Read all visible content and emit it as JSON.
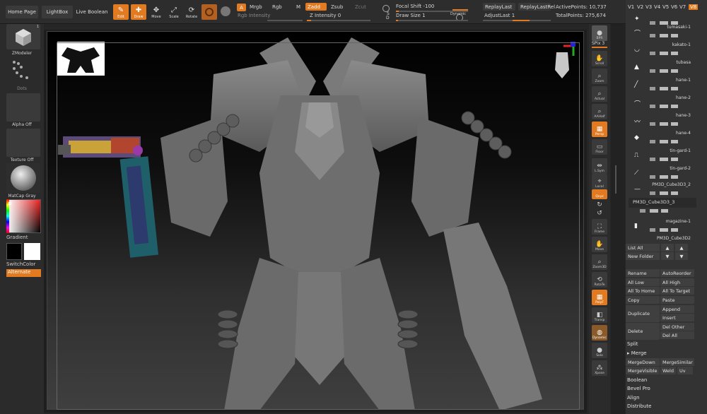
{
  "topbar": {
    "home_page": "Home Page",
    "lightbox": "LightBox",
    "live_boolean": "Live Boolean",
    "tools": [
      {
        "label": "Edit",
        "icon": "edit-icon",
        "active": true
      },
      {
        "label": "Draw",
        "icon": "draw-icon",
        "active": true
      },
      {
        "label": "Move",
        "icon": "move-icon",
        "active": false
      },
      {
        "label": "Scale",
        "icon": "scale-icon",
        "active": false
      },
      {
        "label": "Rotate",
        "icon": "rotate-icon",
        "active": false
      }
    ],
    "a_label": "A",
    "mrgb": "Mrgb",
    "rgb": "Rgb",
    "m": "M",
    "zadd": "Zadd",
    "zsub": "Zsub",
    "zcut": "Zcut",
    "rgb_intensity": "Rgb Intensity",
    "z_intensity": "Z Intensity 0",
    "focal_shift": "Focal Shift -100",
    "draw_size": "Draw Size 1",
    "dynamic": "Dynamic",
    "replay_last": "ReplayLast",
    "replay_last_rel": "ReplayLastRel",
    "adjust_last": "AdjustLast 1",
    "active_points": "ActivePoints: 10,737",
    "total_points": "TotalPoints: 275,674",
    "s_label": "S",
    "d_label": "D"
  },
  "left_shelf": {
    "zmodeler": "ZModeler",
    "dots": "Dots",
    "alpha": "Alpha Off",
    "texture": "Texture Off",
    "matcap": "MatCap Gray",
    "gradient": "Gradient",
    "switch_color": "SwitchColor",
    "alternate": "Alternate",
    "zmodeler_badge": "1"
  },
  "right_shelf": [
    {
      "label": "BPR",
      "icon": "sphere-icon",
      "active": false
    },
    {
      "label": "SPix 3",
      "icon": "",
      "active": false
    },
    {
      "label": "Scroll",
      "icon": "scroll-icon",
      "active": false
    },
    {
      "label": "Zoom",
      "icon": "zoom-icon",
      "active": false
    },
    {
      "label": "Actual",
      "icon": "actual-icon",
      "active": false
    },
    {
      "label": "AAHalf",
      "icon": "aahalf-icon",
      "active": false
    },
    {
      "label": "Persp",
      "icon": "persp-icon",
      "active": true
    },
    {
      "label": "Floor",
      "icon": "floor-icon",
      "active": false
    },
    {
      "label": "L.Sym",
      "icon": "lsym-icon",
      "active": false
    },
    {
      "label": "Local",
      "icon": "local-icon",
      "active": false
    },
    {
      "label": "Qxyz",
      "icon": "xyz-icon",
      "active": true
    },
    {
      "label": "",
      "icon": "rotate-y-icon",
      "active": false
    },
    {
      "label": "",
      "icon": "rotate-z-icon",
      "active": false
    },
    {
      "label": "Frame",
      "icon": "frame-icon",
      "active": false
    },
    {
      "label": "Move",
      "icon": "move-icon",
      "active": false
    },
    {
      "label": "Zoom3D",
      "icon": "zoom3d-icon",
      "active": false
    },
    {
      "label": "RotaTe",
      "icon": "rotate3d-icon",
      "active": false
    },
    {
      "label": "PolyF",
      "icon": "polyf-icon",
      "active": true
    },
    {
      "label": "Transp",
      "icon": "transp-icon",
      "active": false
    },
    {
      "label": "Dynamic",
      "icon": "ghost-icon",
      "active": true
    },
    {
      "label": "Solo",
      "icon": "solo-icon",
      "active": false
    },
    {
      "label": "Xpose",
      "icon": "xpose-icon",
      "active": false
    }
  ],
  "panel": {
    "views": [
      "V1",
      "V2",
      "V3",
      "V4",
      "V5",
      "V6",
      "V7",
      "V8"
    ],
    "subtools": [
      {
        "name": "",
        "icon": "✦"
      },
      {
        "name": "tumasaki-1",
        "icon": "⌒"
      },
      {
        "name": "kakato-1",
        "icon": "◡"
      },
      {
        "name": "tubasa",
        "icon": "▲"
      },
      {
        "name": "hane-1",
        "icon": "╱"
      },
      {
        "name": "hane-2",
        "icon": "⌒"
      },
      {
        "name": "hane-3",
        "icon": "〰"
      },
      {
        "name": "hane-4",
        "icon": "◆"
      },
      {
        "name": "tin-gard-1",
        "icon": "⎍"
      },
      {
        "name": "tin-gard-2",
        "icon": "⟋"
      },
      {
        "name": "PM3D_Cube3D3_2",
        "icon": "—"
      },
      {
        "name": "PM3D_Cube3D3_3",
        "icon": "—"
      },
      {
        "name": "magazine-1",
        "icon": "▮"
      },
      {
        "name": "PM3D_Cube3D2",
        "icon": "▬"
      }
    ],
    "list_all": "List All",
    "new_folder": "New Folder",
    "rename": "Rename",
    "auto_reorder": "AutoReorder",
    "all_low": "All Low",
    "all_high": "All High",
    "all_to_home": "All To Home",
    "all_to_target": "All To Target",
    "copy": "Copy",
    "paste": "Paste",
    "duplicate": "Duplicate",
    "append": "Append",
    "insert": "Insert",
    "delete": "Delete",
    "del_other": "Del Other",
    "del_all": "Del All",
    "split": "Split",
    "merge": "Merge",
    "merge_down": "MergeDown",
    "merge_similar": "MergeSimilar",
    "merge_visible": "MergeVisible",
    "weld": "Weld",
    "uv": "Uv",
    "boolean": "Boolean",
    "bevel_pro": "Bevel Pro",
    "align": "Align",
    "distribute": "Distribute"
  },
  "colors": {
    "accent": "#e27a22",
    "panel": "#333333",
    "button": "#3f3f3f"
  }
}
